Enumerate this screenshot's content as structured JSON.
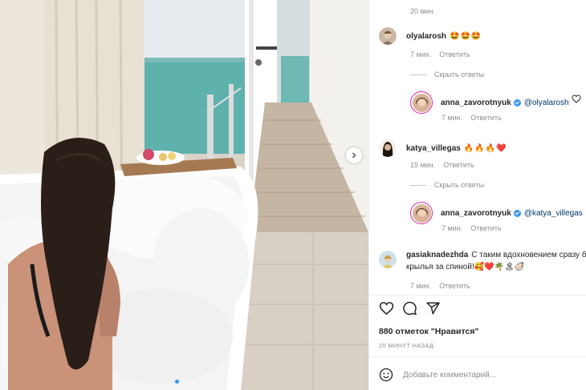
{
  "comments": {
    "top_time": "20 мин.",
    "reply_label": "Ответить",
    "items": [
      {
        "username": "olyalarosh",
        "text": "🤩🤩🤩",
        "time": "7 мин.",
        "hide_replies": "Скрыть ответы"
      },
      {
        "username": "anna_zavorotnyuk",
        "mention": "@olyalarosh",
        "time": "7 мин."
      },
      {
        "username": "katya_villegas",
        "text": "🔥🔥🔥❤️",
        "time": "15 мин.",
        "hide_replies": "Скрыть ответы"
      },
      {
        "username": "anna_zavorotnyuk",
        "mention": "@katya_villegas",
        "time": "7 мин."
      },
      {
        "username": "gasiaknadezhda",
        "text": "С таким вдохновением сразу б",
        "text_line2": "крылья за спиной!🥰❤️🌴🏝🦪",
        "time": "7 мин."
      }
    ]
  },
  "post": {
    "likes": "880 отметок \"Нравится\"",
    "ago": "20 МИНУТ НАЗАД",
    "comment_placeholder": "Добавьте комментарий..."
  },
  "carousel": {
    "count": 2,
    "active_index": 0
  },
  "icons": [
    "heart-icon",
    "comment-icon",
    "share-icon",
    "emoji-icon",
    "chevron-right-icon",
    "verified-icon"
  ],
  "colors": {
    "link": "#00376b",
    "muted": "#8e8e8e",
    "verified": "#3897f0",
    "story_ring": "#d6249f"
  }
}
